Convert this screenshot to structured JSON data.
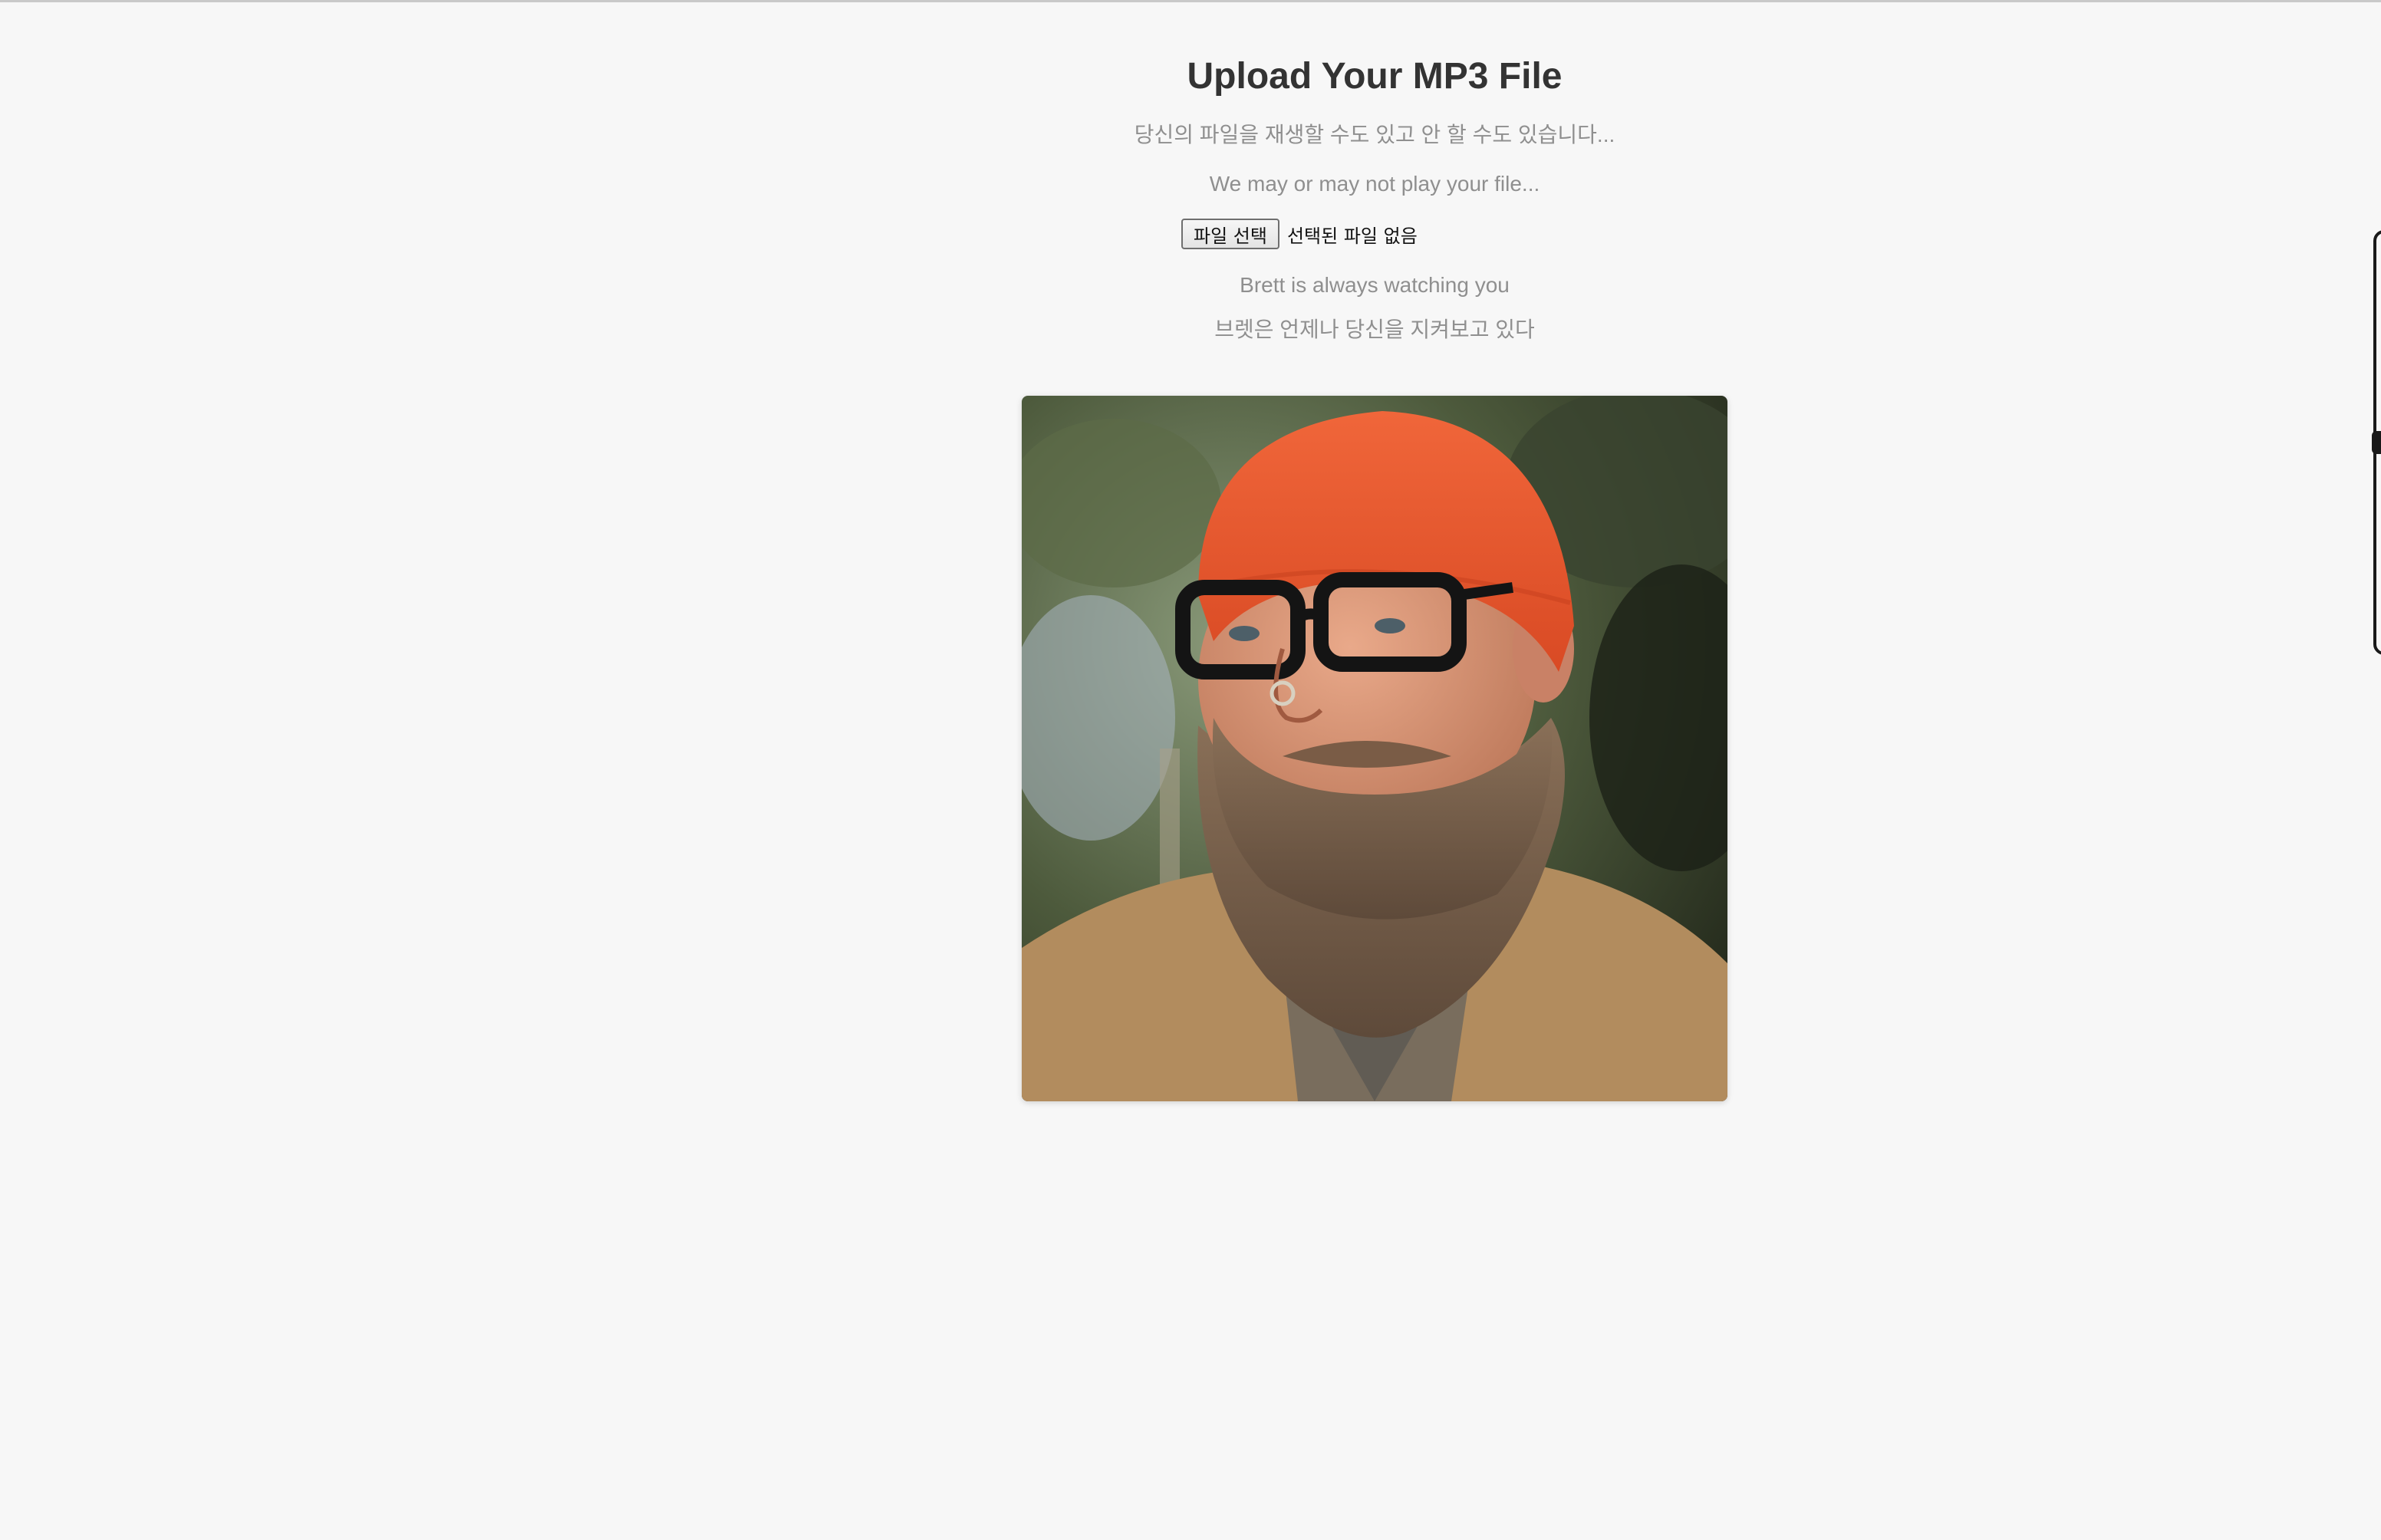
{
  "page": {
    "title": "Upload Your MP3 File",
    "subtitle_ko": "당신의 파일을 재생할 수도 있고 안 할 수도 있습니다...",
    "subtitle_en": "We may or may not play your file...",
    "watching_en": "Brett is always watching you",
    "watching_ko": "브렛은 언제나 당신을 지켜보고 있다"
  },
  "file_input": {
    "button_label": "파일 선택",
    "status": "선택된 파일 없음"
  },
  "colors": {
    "background": "#f7f7f7",
    "title": "#333333",
    "subtitle": "#8f8f8f",
    "beanie": "#e5532c",
    "jacket": "#b08a5c"
  }
}
